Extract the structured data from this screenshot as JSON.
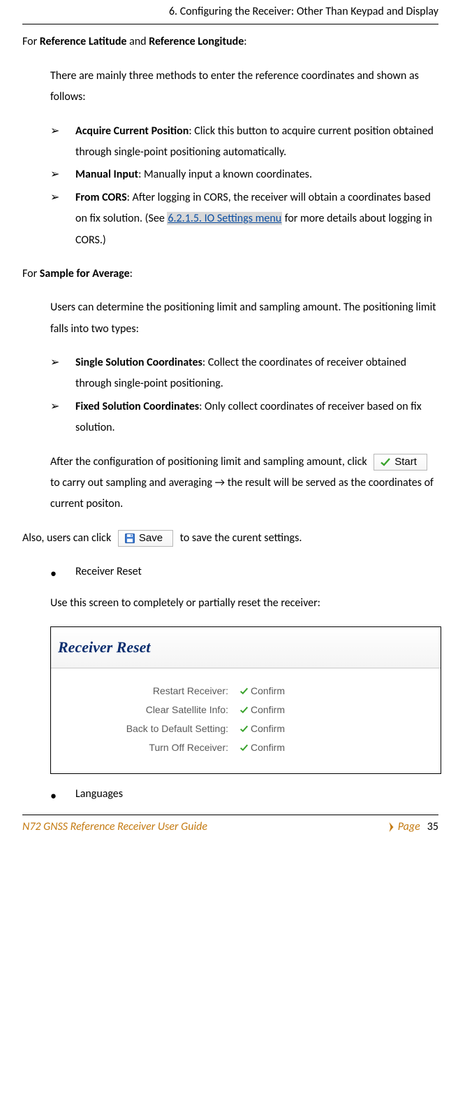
{
  "header": "6. Configuring the Receiver: Other Than Keypad and Display",
  "p1_prefix": "For ",
  "p1_b1": "Reference Latitude",
  "p1_mid": " and ",
  "p1_b2": "Reference Longitude",
  "p1_suffix": ":",
  "p2": "There are mainly three methods to enter the reference coordinates and shown as follows:",
  "list1": {
    "a_bold": "Acquire Current Position",
    "a_rest": ": Click this button to acquire current position obtained through single-point positioning automatically.",
    "b_bold": "Manual Input",
    "b_rest": ": Manually input a known coordinates.",
    "c_bold": "From CORS",
    "c_rest1": ": After logging in CORS, the receiver will obtain a coordinates based on fix solution. (See ",
    "c_link": "6.2.1.5. IO Settings menu",
    "c_rest2": " for more details about logging in CORS.)"
  },
  "p3_prefix": "For ",
  "p3_bold": "Sample for Average",
  "p3_suffix": ":",
  "p4": "Users can determine the positioning limit and sampling amount. The positioning limit falls into two types:",
  "list2": {
    "a_bold": "Single Solution Coordinates",
    "a_rest": ": Collect the coordinates of receiver obtained through single-point positioning.",
    "b_bold": "Fixed Solution Coordinates",
    "b_rest": ": Only collect coordinates of receiver based on fix solution."
  },
  "p5_part1": "After the configuration of positioning limit and sampling amount, click ",
  "btn_start": "Start",
  "p5_part2": " to carry out sampling and averaging → the result will be served as the coordinates of current positon.",
  "p6_part1": "Also, users can click ",
  "btn_save": "Save",
  "p6_part2": " to save the curent settings.",
  "list3_a": "Receiver Reset",
  "p7": "Use this screen to completely or partially reset the receiver:",
  "screenshot": {
    "title": "Receiver Reset",
    "rows": [
      {
        "label": "Restart Receiver:",
        "action": "Confirm"
      },
      {
        "label": "Clear Satellite Info:",
        "action": "Confirm"
      },
      {
        "label": "Back to Default Setting:",
        "action": "Confirm"
      },
      {
        "label": "Turn Off Receiver:",
        "action": "Confirm"
      }
    ]
  },
  "list4_a": "Languages",
  "footer": {
    "guide": "N72 GNSS Reference Receiver User Guide",
    "pageLabel": "Page",
    "pageNum": "35"
  }
}
